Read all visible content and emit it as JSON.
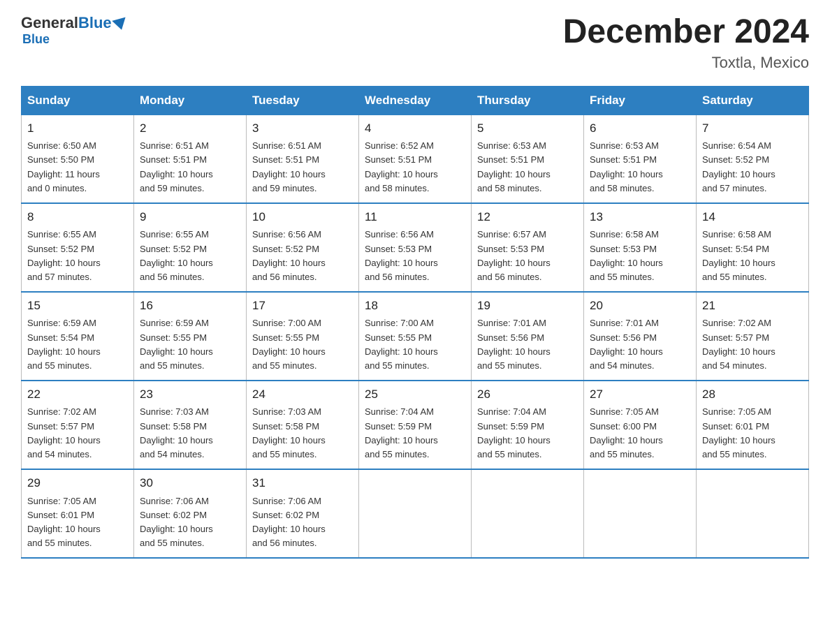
{
  "header": {
    "logo_general": "General",
    "logo_blue": "Blue",
    "month_title": "December 2024",
    "location": "Toxtla, Mexico"
  },
  "days_of_week": [
    "Sunday",
    "Monday",
    "Tuesday",
    "Wednesday",
    "Thursday",
    "Friday",
    "Saturday"
  ],
  "weeks": [
    [
      {
        "day": "1",
        "sunrise": "6:50 AM",
        "sunset": "5:50 PM",
        "daylight": "11 hours and 0 minutes."
      },
      {
        "day": "2",
        "sunrise": "6:51 AM",
        "sunset": "5:51 PM",
        "daylight": "10 hours and 59 minutes."
      },
      {
        "day": "3",
        "sunrise": "6:51 AM",
        "sunset": "5:51 PM",
        "daylight": "10 hours and 59 minutes."
      },
      {
        "day": "4",
        "sunrise": "6:52 AM",
        "sunset": "5:51 PM",
        "daylight": "10 hours and 58 minutes."
      },
      {
        "day": "5",
        "sunrise": "6:53 AM",
        "sunset": "5:51 PM",
        "daylight": "10 hours and 58 minutes."
      },
      {
        "day": "6",
        "sunrise": "6:53 AM",
        "sunset": "5:51 PM",
        "daylight": "10 hours and 58 minutes."
      },
      {
        "day": "7",
        "sunrise": "6:54 AM",
        "sunset": "5:52 PM",
        "daylight": "10 hours and 57 minutes."
      }
    ],
    [
      {
        "day": "8",
        "sunrise": "6:55 AM",
        "sunset": "5:52 PM",
        "daylight": "10 hours and 57 minutes."
      },
      {
        "day": "9",
        "sunrise": "6:55 AM",
        "sunset": "5:52 PM",
        "daylight": "10 hours and 56 minutes."
      },
      {
        "day": "10",
        "sunrise": "6:56 AM",
        "sunset": "5:52 PM",
        "daylight": "10 hours and 56 minutes."
      },
      {
        "day": "11",
        "sunrise": "6:56 AM",
        "sunset": "5:53 PM",
        "daylight": "10 hours and 56 minutes."
      },
      {
        "day": "12",
        "sunrise": "6:57 AM",
        "sunset": "5:53 PM",
        "daylight": "10 hours and 56 minutes."
      },
      {
        "day": "13",
        "sunrise": "6:58 AM",
        "sunset": "5:53 PM",
        "daylight": "10 hours and 55 minutes."
      },
      {
        "day": "14",
        "sunrise": "6:58 AM",
        "sunset": "5:54 PM",
        "daylight": "10 hours and 55 minutes."
      }
    ],
    [
      {
        "day": "15",
        "sunrise": "6:59 AM",
        "sunset": "5:54 PM",
        "daylight": "10 hours and 55 minutes."
      },
      {
        "day": "16",
        "sunrise": "6:59 AM",
        "sunset": "5:55 PM",
        "daylight": "10 hours and 55 minutes."
      },
      {
        "day": "17",
        "sunrise": "7:00 AM",
        "sunset": "5:55 PM",
        "daylight": "10 hours and 55 minutes."
      },
      {
        "day": "18",
        "sunrise": "7:00 AM",
        "sunset": "5:55 PM",
        "daylight": "10 hours and 55 minutes."
      },
      {
        "day": "19",
        "sunrise": "7:01 AM",
        "sunset": "5:56 PM",
        "daylight": "10 hours and 55 minutes."
      },
      {
        "day": "20",
        "sunrise": "7:01 AM",
        "sunset": "5:56 PM",
        "daylight": "10 hours and 54 minutes."
      },
      {
        "day": "21",
        "sunrise": "7:02 AM",
        "sunset": "5:57 PM",
        "daylight": "10 hours and 54 minutes."
      }
    ],
    [
      {
        "day": "22",
        "sunrise": "7:02 AM",
        "sunset": "5:57 PM",
        "daylight": "10 hours and 54 minutes."
      },
      {
        "day": "23",
        "sunrise": "7:03 AM",
        "sunset": "5:58 PM",
        "daylight": "10 hours and 54 minutes."
      },
      {
        "day": "24",
        "sunrise": "7:03 AM",
        "sunset": "5:58 PM",
        "daylight": "10 hours and 55 minutes."
      },
      {
        "day": "25",
        "sunrise": "7:04 AM",
        "sunset": "5:59 PM",
        "daylight": "10 hours and 55 minutes."
      },
      {
        "day": "26",
        "sunrise": "7:04 AM",
        "sunset": "5:59 PM",
        "daylight": "10 hours and 55 minutes."
      },
      {
        "day": "27",
        "sunrise": "7:05 AM",
        "sunset": "6:00 PM",
        "daylight": "10 hours and 55 minutes."
      },
      {
        "day": "28",
        "sunrise": "7:05 AM",
        "sunset": "6:01 PM",
        "daylight": "10 hours and 55 minutes."
      }
    ],
    [
      {
        "day": "29",
        "sunrise": "7:05 AM",
        "sunset": "6:01 PM",
        "daylight": "10 hours and 55 minutes."
      },
      {
        "day": "30",
        "sunrise": "7:06 AM",
        "sunset": "6:02 PM",
        "daylight": "10 hours and 55 minutes."
      },
      {
        "day": "31",
        "sunrise": "7:06 AM",
        "sunset": "6:02 PM",
        "daylight": "10 hours and 56 minutes."
      },
      null,
      null,
      null,
      null
    ]
  ],
  "labels": {
    "sunrise": "Sunrise:",
    "sunset": "Sunset:",
    "daylight": "Daylight:"
  }
}
